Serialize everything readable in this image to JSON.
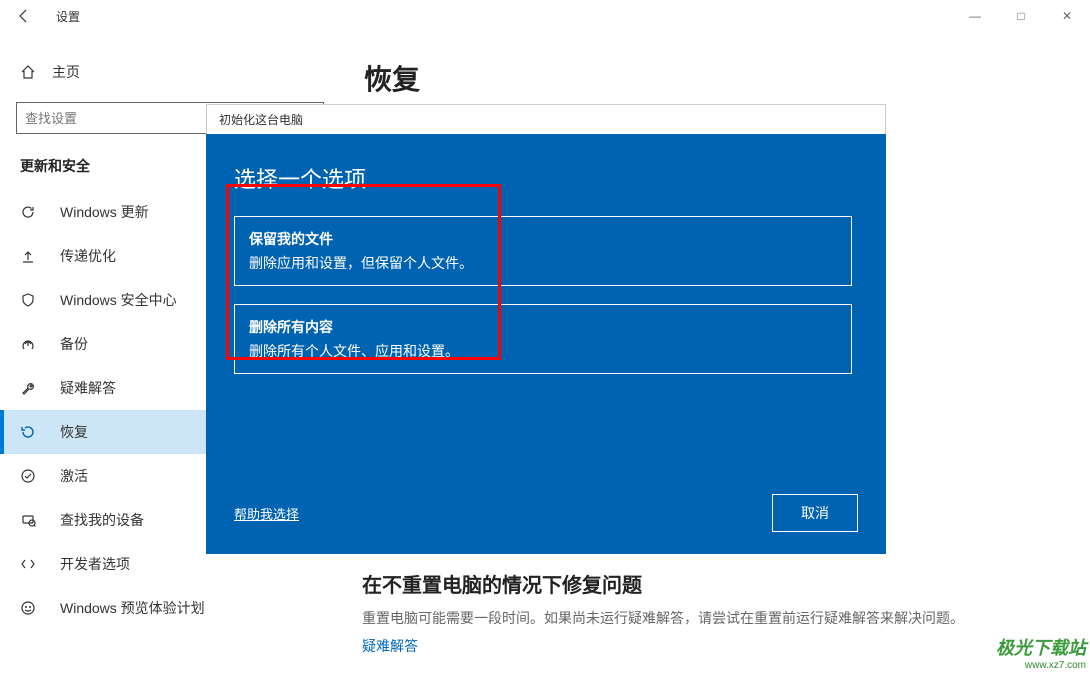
{
  "window": {
    "title": "设置",
    "controls": {
      "min": "—",
      "max": "□",
      "close": "✕"
    }
  },
  "sidebar": {
    "home_label": "主页",
    "search_placeholder": "查找设置",
    "section_title": "更新和安全",
    "items": [
      {
        "icon": "↻",
        "label": "Windows 更新"
      },
      {
        "icon": "⇪",
        "label": "传递优化"
      },
      {
        "icon": "⛨",
        "label": "Windows 安全中心"
      },
      {
        "icon": "↑",
        "label": "备份"
      },
      {
        "icon": "✎",
        "label": "疑难解答"
      },
      {
        "icon": "⟳",
        "label": "恢复"
      },
      {
        "icon": "✓",
        "label": "激活"
      },
      {
        "icon": "⌕",
        "label": "查找我的设备"
      },
      {
        "icon": "{}",
        "label": "开发者选项"
      },
      {
        "icon": "☻",
        "label": "Windows 预览体验计划"
      }
    ]
  },
  "content": {
    "heading": "恢复",
    "repair": {
      "heading": "在不重置电脑的情况下修复问题",
      "text": "重置电脑可能需要一段时间。如果尚未运行疑难解答，请尝试在重置前运行疑难解答来解决问题。",
      "link": "疑难解答"
    }
  },
  "modal": {
    "title": "初始化这台电脑",
    "heading": "选择一个选项",
    "options": [
      {
        "title": "保留我的文件",
        "desc": "删除应用和设置，但保留个人文件。"
      },
      {
        "title": "删除所有内容",
        "desc": "删除所有个人文件、应用和设置。"
      }
    ],
    "help_link": "帮助我选择",
    "cancel": "取消"
  },
  "watermark": {
    "brand": "极光下载站",
    "url": "www.xz7.com"
  }
}
